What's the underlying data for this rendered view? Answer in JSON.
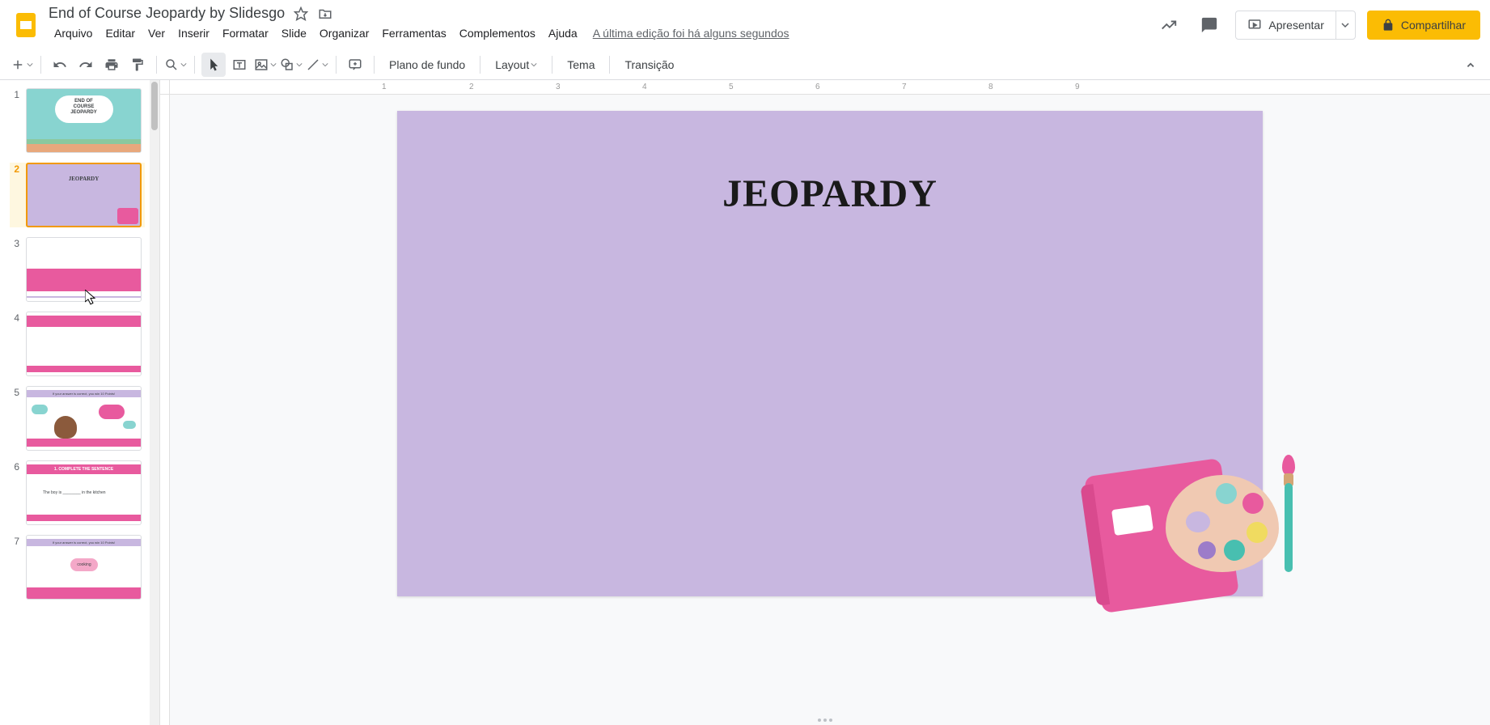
{
  "doc_title": "End of Course Jeopardy by Slidesgo",
  "menubar": {
    "file": "Arquivo",
    "edit": "Editar",
    "view": "Ver",
    "insert": "Inserir",
    "format": "Formatar",
    "slide": "Slide",
    "arrange": "Organizar",
    "tools": "Ferramentas",
    "addons": "Complementos",
    "help": "Ajuda"
  },
  "last_edit": "A última edição foi há alguns segundos",
  "present_label": "Apresentar",
  "share_label": "Compartilhar",
  "toolbar": {
    "background": "Plano de fundo",
    "layout": "Layout",
    "theme": "Tema",
    "transition": "Transição"
  },
  "ruler": [
    "1",
    "2",
    "3",
    "4",
    "5",
    "6",
    "7",
    "8",
    "9"
  ],
  "thumbs": {
    "1": {
      "line1": "END OF",
      "line2": "COURSE",
      "line3": "JEOPARDY"
    },
    "2": {
      "title": "JEOPARDY"
    },
    "5": {
      "head": "If your answer is correct, you win 10 Points!"
    },
    "6": {
      "head": "1. COMPLETE THE SENTENCE",
      "text": "The boy is ________ in the kitchen"
    },
    "7": {
      "head": "If your answer is correct, you win 10 Points!",
      "bubble": "cooking"
    }
  },
  "slide": {
    "title": "JEOPARDY"
  }
}
